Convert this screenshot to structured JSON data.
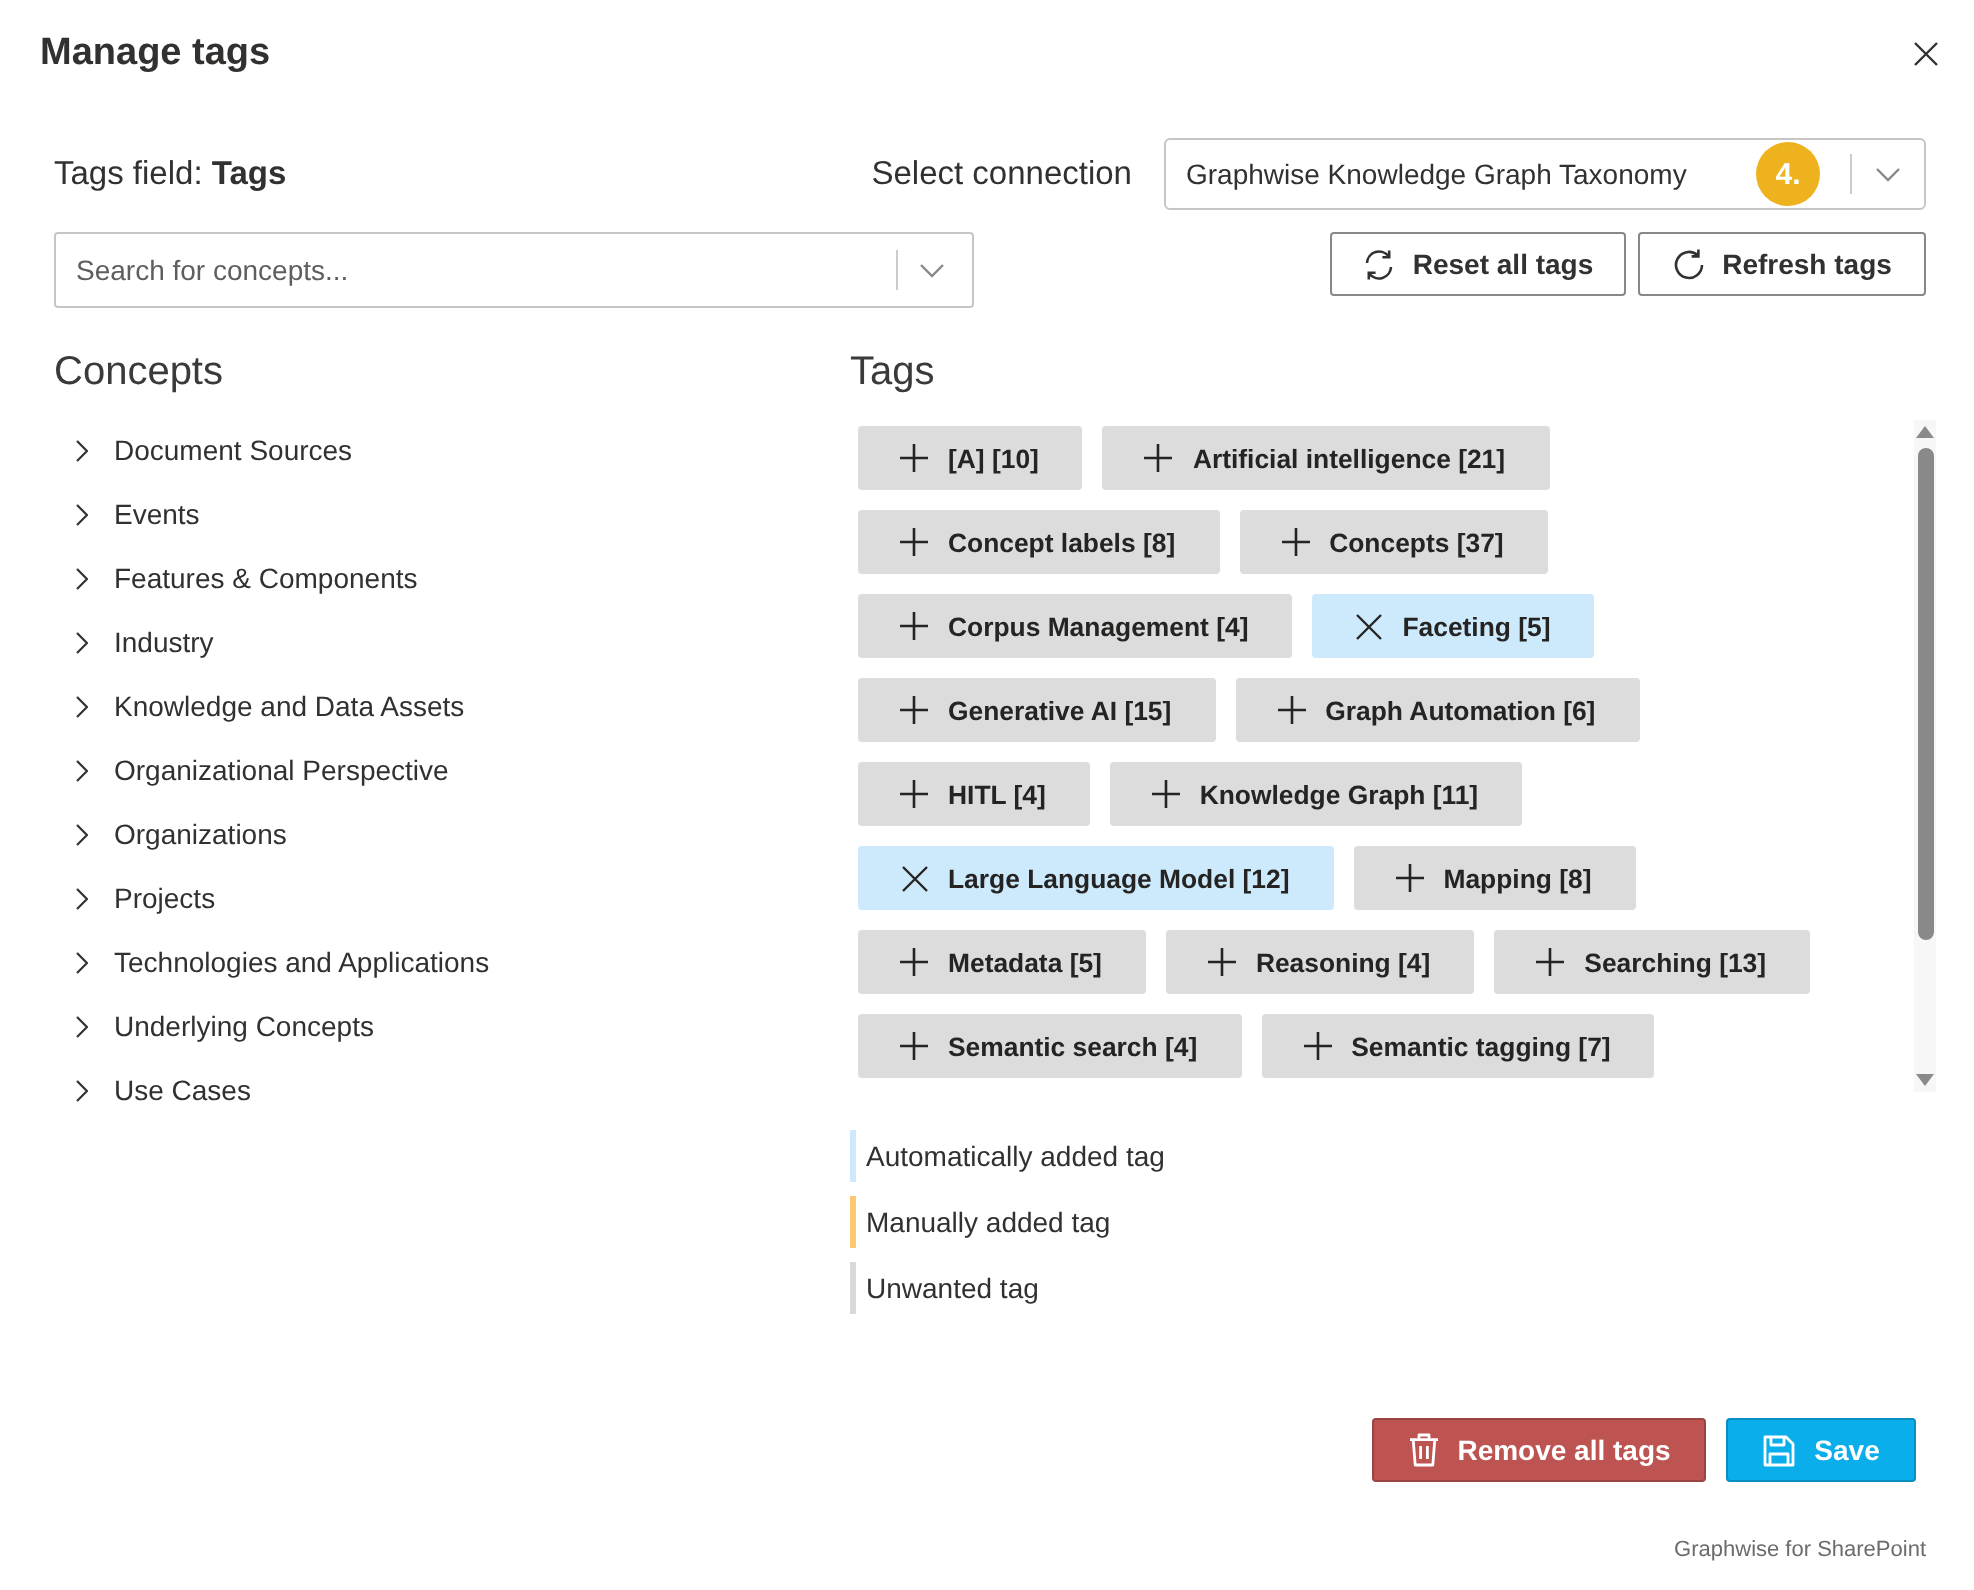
{
  "dialog": {
    "title": "Manage tags"
  },
  "tags_field": {
    "text": "Tags field: **Tags**"
  },
  "connection": {
    "label": "Select connection",
    "value": "Graphwise Knowledge Graph Taxonomy",
    "step_badge": "4."
  },
  "search": {
    "placeholder": "Search for concepts..."
  },
  "toolbar_buttons": [
    {
      "label": "Reset all tags",
      "kind": "reset"
    },
    {
      "label": "Refresh tags",
      "kind": "refresh"
    }
  ],
  "concepts": {
    "heading": "Concepts",
    "items": [
      {
        "label": "Document Sources",
        "expanded": false
      },
      {
        "label": "Events",
        "expanded": false
      },
      {
        "label": "Features & Components",
        "expanded": false
      },
      {
        "label": "Industry",
        "expanded": false
      },
      {
        "label": "Knowledge and Data Assets",
        "expanded": false
      },
      {
        "label": "Organizational Perspective",
        "expanded": false
      },
      {
        "label": "Organizations",
        "expanded": false
      },
      {
        "label": "Projects",
        "expanded": false
      },
      {
        "label": "Technologies and Applications",
        "expanded": false
      },
      {
        "label": "Underlying Concepts",
        "expanded": false
      },
      {
        "label": "Use Cases",
        "expanded": false
      }
    ]
  },
  "tags": {
    "heading": "Tags",
    "items": [
      {
        "label": "[A] [10]",
        "kind": "unwanted"
      },
      {
        "label": "Artificial intelligence [21]",
        "kind": "unwanted"
      },
      {
        "label": "Concept labels [8]",
        "kind": "unwanted"
      },
      {
        "label": "Concepts [37]",
        "kind": "unwanted"
      },
      {
        "label": "Corpus Management [4]",
        "kind": "unwanted"
      },
      {
        "label": "Faceting [5]",
        "kind": "automatic"
      },
      {
        "label": "Generative AI [15]",
        "kind": "unwanted"
      },
      {
        "label": "Graph Automation [6]",
        "kind": "unwanted"
      },
      {
        "label": "HITL [4]",
        "kind": "unwanted"
      },
      {
        "label": "Knowledge Graph [11]",
        "kind": "unwanted"
      },
      {
        "label": "Large Language Model [12]",
        "kind": "automatic"
      },
      {
        "label": "Mapping [8]",
        "kind": "unwanted"
      },
      {
        "label": "Metadata [5]",
        "kind": "unwanted"
      },
      {
        "label": "Reasoning [4]",
        "kind": "unwanted"
      },
      {
        "label": "Searching [13]",
        "kind": "unwanted"
      },
      {
        "label": "Semantic search [4]",
        "kind": "unwanted"
      },
      {
        "label": "Semantic tagging [7]",
        "kind": "unwanted"
      }
    ]
  },
  "legend": [
    {
      "label": "Automatically added tag",
      "color": "#cdeafd"
    },
    {
      "label": "Manually added tag",
      "color": "#fcc96f"
    },
    {
      "label": "Unwanted tag",
      "color": "#d9d9d9"
    }
  ],
  "actions": [
    {
      "label": "Remove all tags",
      "kind": "danger"
    },
    {
      "label": "Save",
      "kind": "primary"
    }
  ],
  "footer": {
    "text": "Graphwise for SharePoint"
  }
}
